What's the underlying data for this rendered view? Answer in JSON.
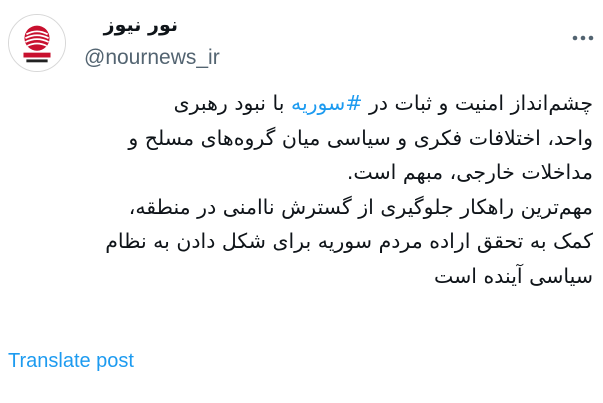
{
  "header": {
    "display_name": "نور نیوز",
    "handle": "@nournews_ir",
    "avatar_icon": "nournews-logo-icon",
    "more_icon": "more-options-icon"
  },
  "tweet": {
    "line1_before": "چشم‌انداز امنیت و ثبات در ",
    "hashtag": "#سوریه",
    "line1_after": " با نبود رهبری",
    "line2": "واحد، اختلافات فکری و سیاسی میان گروه‌های مسلح و",
    "line3": "مداخلات خارجی، مبهم است.",
    "line4": "مهم‌ترین راهکار جلوگیری از گسترش ناامنی در منطقه،",
    "line5": "کمک به تحقق اراده مردم سوریه برای شکل دادن به نظام",
    "line6": "سیاسی آینده است"
  },
  "actions": {
    "translate_label": "Translate post"
  },
  "colors": {
    "link": "#1d9bf0",
    "text": "#0f1419",
    "secondary": "#536471",
    "logo_red": "#c8102e"
  }
}
